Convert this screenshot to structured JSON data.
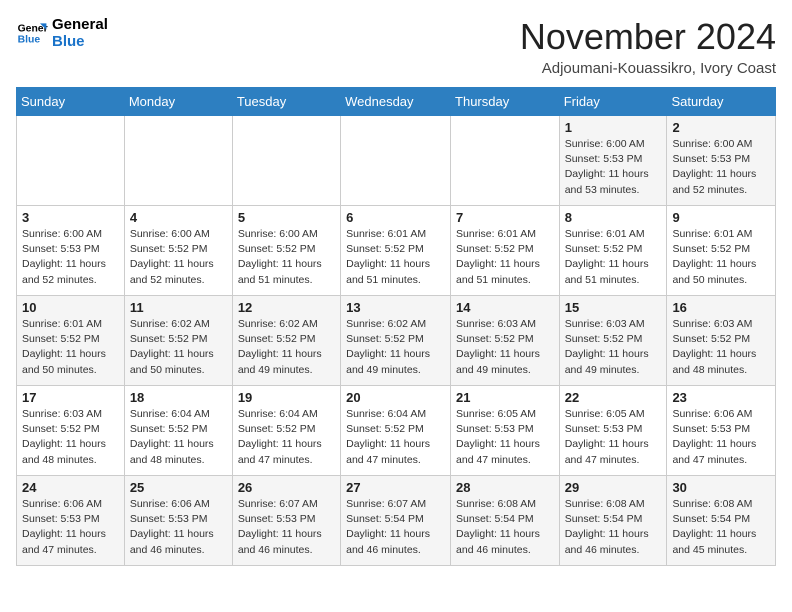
{
  "header": {
    "logo_line1": "General",
    "logo_line2": "Blue",
    "month": "November 2024",
    "location": "Adjoumani-Kouassikro, Ivory Coast"
  },
  "days_of_week": [
    "Sunday",
    "Monday",
    "Tuesday",
    "Wednesday",
    "Thursday",
    "Friday",
    "Saturday"
  ],
  "weeks": [
    [
      {
        "day": "",
        "info": ""
      },
      {
        "day": "",
        "info": ""
      },
      {
        "day": "",
        "info": ""
      },
      {
        "day": "",
        "info": ""
      },
      {
        "day": "",
        "info": ""
      },
      {
        "day": "1",
        "info": "Sunrise: 6:00 AM\nSunset: 5:53 PM\nDaylight: 11 hours and 53 minutes."
      },
      {
        "day": "2",
        "info": "Sunrise: 6:00 AM\nSunset: 5:53 PM\nDaylight: 11 hours and 52 minutes."
      }
    ],
    [
      {
        "day": "3",
        "info": "Sunrise: 6:00 AM\nSunset: 5:53 PM\nDaylight: 11 hours and 52 minutes."
      },
      {
        "day": "4",
        "info": "Sunrise: 6:00 AM\nSunset: 5:52 PM\nDaylight: 11 hours and 52 minutes."
      },
      {
        "day": "5",
        "info": "Sunrise: 6:00 AM\nSunset: 5:52 PM\nDaylight: 11 hours and 51 minutes."
      },
      {
        "day": "6",
        "info": "Sunrise: 6:01 AM\nSunset: 5:52 PM\nDaylight: 11 hours and 51 minutes."
      },
      {
        "day": "7",
        "info": "Sunrise: 6:01 AM\nSunset: 5:52 PM\nDaylight: 11 hours and 51 minutes."
      },
      {
        "day": "8",
        "info": "Sunrise: 6:01 AM\nSunset: 5:52 PM\nDaylight: 11 hours and 51 minutes."
      },
      {
        "day": "9",
        "info": "Sunrise: 6:01 AM\nSunset: 5:52 PM\nDaylight: 11 hours and 50 minutes."
      }
    ],
    [
      {
        "day": "10",
        "info": "Sunrise: 6:01 AM\nSunset: 5:52 PM\nDaylight: 11 hours and 50 minutes."
      },
      {
        "day": "11",
        "info": "Sunrise: 6:02 AM\nSunset: 5:52 PM\nDaylight: 11 hours and 50 minutes."
      },
      {
        "day": "12",
        "info": "Sunrise: 6:02 AM\nSunset: 5:52 PM\nDaylight: 11 hours and 49 minutes."
      },
      {
        "day": "13",
        "info": "Sunrise: 6:02 AM\nSunset: 5:52 PM\nDaylight: 11 hours and 49 minutes."
      },
      {
        "day": "14",
        "info": "Sunrise: 6:03 AM\nSunset: 5:52 PM\nDaylight: 11 hours and 49 minutes."
      },
      {
        "day": "15",
        "info": "Sunrise: 6:03 AM\nSunset: 5:52 PM\nDaylight: 11 hours and 49 minutes."
      },
      {
        "day": "16",
        "info": "Sunrise: 6:03 AM\nSunset: 5:52 PM\nDaylight: 11 hours and 48 minutes."
      }
    ],
    [
      {
        "day": "17",
        "info": "Sunrise: 6:03 AM\nSunset: 5:52 PM\nDaylight: 11 hours and 48 minutes."
      },
      {
        "day": "18",
        "info": "Sunrise: 6:04 AM\nSunset: 5:52 PM\nDaylight: 11 hours and 48 minutes."
      },
      {
        "day": "19",
        "info": "Sunrise: 6:04 AM\nSunset: 5:52 PM\nDaylight: 11 hours and 47 minutes."
      },
      {
        "day": "20",
        "info": "Sunrise: 6:04 AM\nSunset: 5:52 PM\nDaylight: 11 hours and 47 minutes."
      },
      {
        "day": "21",
        "info": "Sunrise: 6:05 AM\nSunset: 5:53 PM\nDaylight: 11 hours and 47 minutes."
      },
      {
        "day": "22",
        "info": "Sunrise: 6:05 AM\nSunset: 5:53 PM\nDaylight: 11 hours and 47 minutes."
      },
      {
        "day": "23",
        "info": "Sunrise: 6:06 AM\nSunset: 5:53 PM\nDaylight: 11 hours and 47 minutes."
      }
    ],
    [
      {
        "day": "24",
        "info": "Sunrise: 6:06 AM\nSunset: 5:53 PM\nDaylight: 11 hours and 47 minutes."
      },
      {
        "day": "25",
        "info": "Sunrise: 6:06 AM\nSunset: 5:53 PM\nDaylight: 11 hours and 46 minutes."
      },
      {
        "day": "26",
        "info": "Sunrise: 6:07 AM\nSunset: 5:53 PM\nDaylight: 11 hours and 46 minutes."
      },
      {
        "day": "27",
        "info": "Sunrise: 6:07 AM\nSunset: 5:54 PM\nDaylight: 11 hours and 46 minutes."
      },
      {
        "day": "28",
        "info": "Sunrise: 6:08 AM\nSunset: 5:54 PM\nDaylight: 11 hours and 46 minutes."
      },
      {
        "day": "29",
        "info": "Sunrise: 6:08 AM\nSunset: 5:54 PM\nDaylight: 11 hours and 46 minutes."
      },
      {
        "day": "30",
        "info": "Sunrise: 6:08 AM\nSunset: 5:54 PM\nDaylight: 11 hours and 45 minutes."
      }
    ]
  ]
}
